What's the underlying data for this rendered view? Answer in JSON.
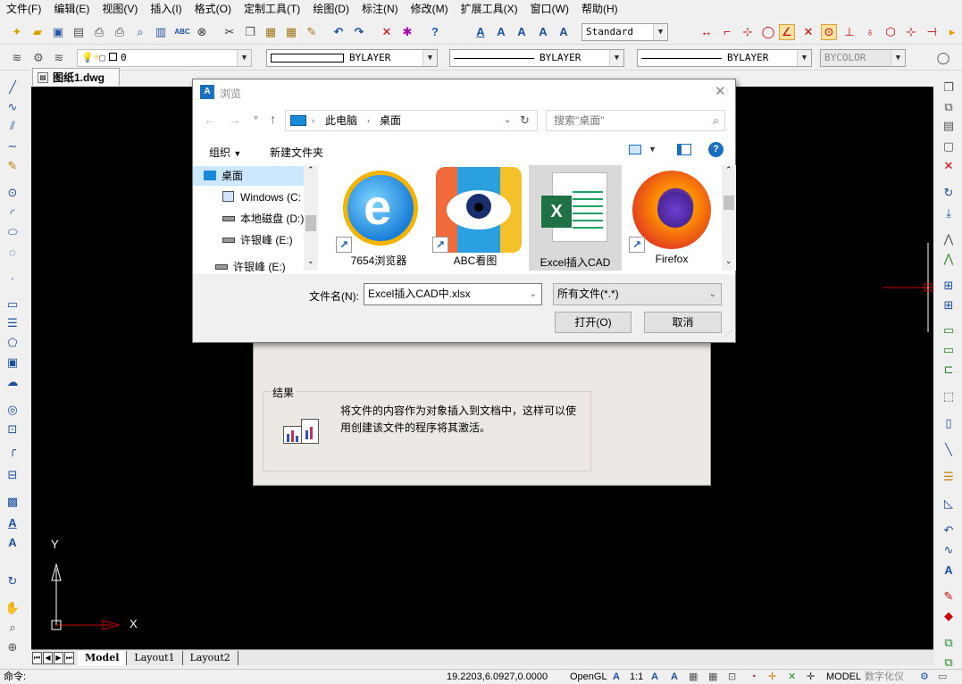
{
  "menu": [
    "文件(F)",
    "编辑(E)",
    "视图(V)",
    "插入(I)",
    "格式(O)",
    "定制工具(T)",
    "绘图(D)",
    "标注(N)",
    "修改(M)",
    "扩展工具(X)",
    "窗口(W)",
    "帮助(H)"
  ],
  "toolbar": {
    "text_style": "Standard",
    "layer_name": "0",
    "color": "BYLAYER",
    "linetype": "BYLAYER",
    "lineweight": "BYLAYER",
    "plotstyle": "BYCOLOR",
    "abc_label": "ABC"
  },
  "document": {
    "tab": "图纸1.dwg"
  },
  "layouts": [
    "Model",
    "Layout1",
    "Layout2"
  ],
  "ucs": {
    "x": "X",
    "y": "Y"
  },
  "status": {
    "command_label": "命令:",
    "coords": "19.2203,6.0927,0.0000",
    "render": "OpenGL",
    "scale": "1:1",
    "model": "MODEL",
    "digitizer": "数字化仪"
  },
  "insert_dialog": {
    "result_label": "结果",
    "result_text": "将文件的内容作为对象插入到文档中，这样可以使用创建该文件的程序将其激活。"
  },
  "browse": {
    "title": "浏览",
    "breadcrumb": [
      "此电脑",
      "桌面"
    ],
    "search_placeholder": "搜索\"桌面\"",
    "organize": "组织",
    "new_folder": "新建文件夹",
    "nav_items": [
      "桌面",
      "Windows (C:",
      "本地磁盘 (D:)",
      "许银峰 (E:)",
      "许银峰 (E:)"
    ],
    "files": [
      "7654浏览器",
      "ABC看图",
      "Excel插入CAD",
      "Firefox"
    ],
    "filename_label": "文件名(N):",
    "filename_value": "Excel插入CAD中.xlsx",
    "filetype": "所有文件(*.*)",
    "open_button": "打开(O)",
    "cancel_button": "取消"
  },
  "colors": {
    "accent": "#0078d7",
    "canvas": "#000000",
    "ucs_red": "#cc0000"
  }
}
